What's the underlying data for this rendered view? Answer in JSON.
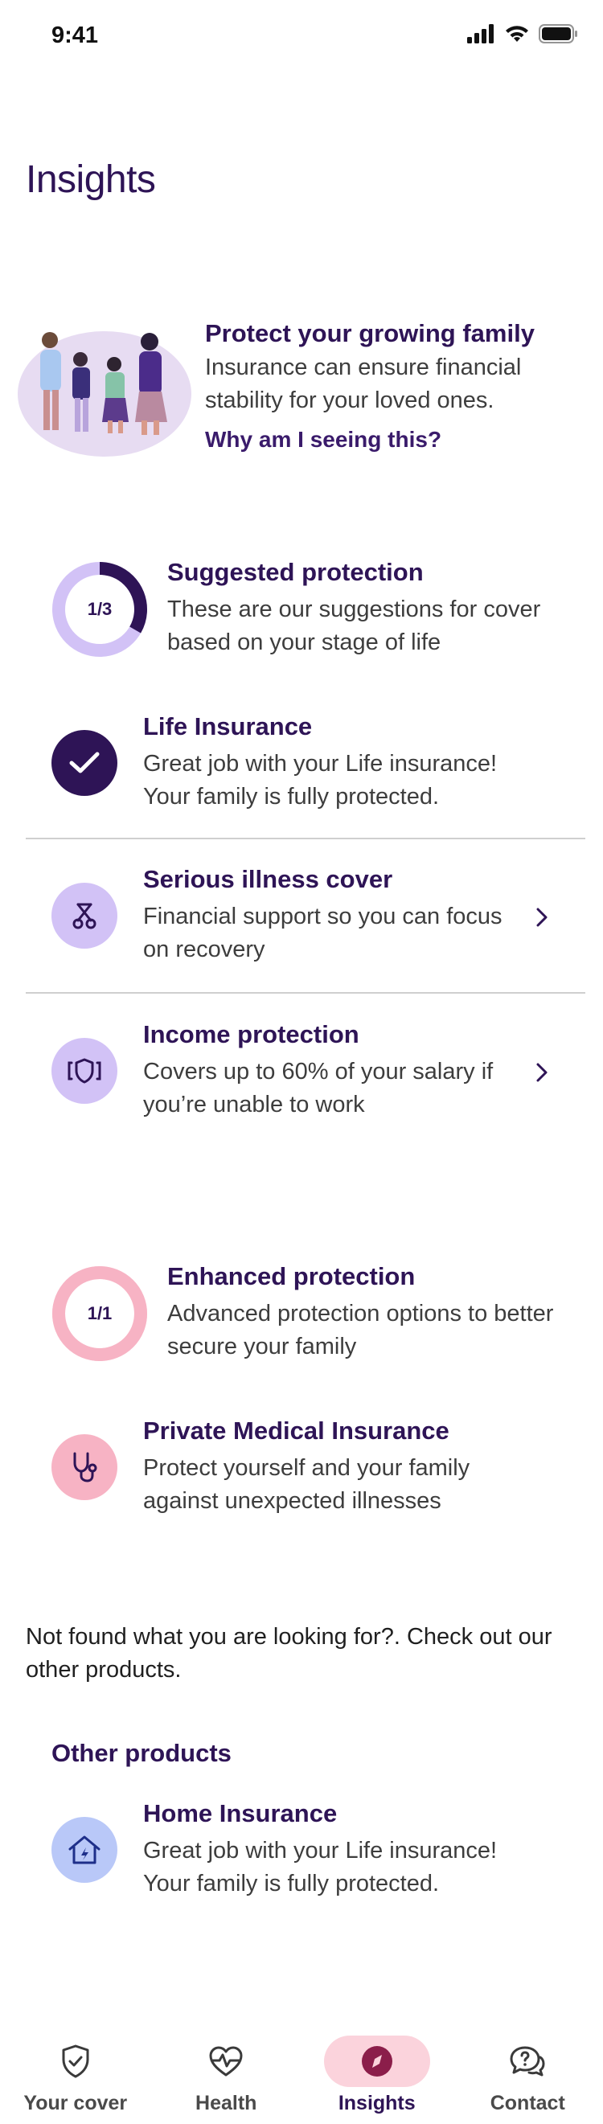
{
  "status_bar": {
    "time": "9:41"
  },
  "page": {
    "title": "Insights"
  },
  "hero": {
    "title": "Protect your growing family",
    "body": "Insurance can ensure financial stability for your loved ones.",
    "link": "Why am I seeing this?"
  },
  "suggested": {
    "progress_label": "1/3",
    "progress_fraction": 0.333,
    "title": "Suggested protection",
    "body": "These are our suggestions for cover based on your stage of life",
    "items": [
      {
        "title": "Life Insurance",
        "body": "Great job with your Life insurance! Your family is fully protected.",
        "icon": "check-icon"
      },
      {
        "title": "Serious illness cover",
        "body": "Financial support so you can focus on recovery",
        "icon": "ribbon-icon"
      },
      {
        "title": "Income protection",
        "body": "Covers up to 60% of your salary if you’re unable to work",
        "icon": "shield-income-icon"
      }
    ]
  },
  "enhanced": {
    "progress_label": "1/1",
    "progress_fraction": 1.0,
    "title": "Enhanced protection",
    "body": "Advanced protection options to better secure your family",
    "items": [
      {
        "title": "Private Medical Insurance",
        "body": "Protect yourself and your family against unexpected illnesses",
        "icon": "stethoscope-icon"
      }
    ]
  },
  "other": {
    "prompt": "Not found what you are looking for?. Check out our other products.",
    "heading": "Other products",
    "items": [
      {
        "title": "Home Insurance",
        "body": "Great job with your Life insurance! Your family is fully protected.",
        "icon": "home-icon"
      }
    ]
  },
  "nav": {
    "items": [
      {
        "label": "Your cover",
        "icon": "shield-check-icon"
      },
      {
        "label": "Health",
        "icon": "heart-pulse-icon"
      },
      {
        "label": "Insights",
        "icon": "compass-icon"
      },
      {
        "label": "Contact",
        "icon": "chat-question-icon"
      }
    ],
    "active": "Insights"
  },
  "colors": {
    "primary": "#2e1456",
    "lavender": "#d2c2f6",
    "lavender_light": "#e3d8fb",
    "pink": "#f7b3c4",
    "pink_light": "#fbd3dc",
    "blue_light": "#b9c8f8"
  }
}
